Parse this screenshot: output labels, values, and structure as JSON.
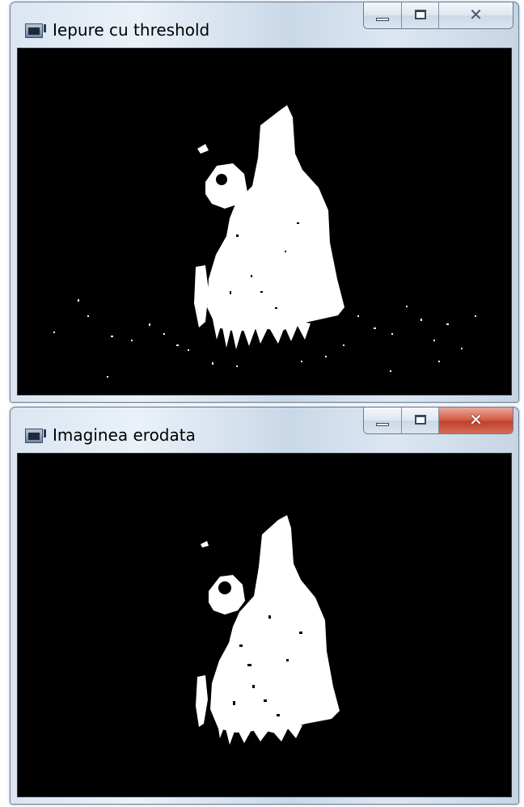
{
  "windows": [
    {
      "title": "Iepure cu threshold",
      "icon": "opencv-window-icon",
      "controls": {
        "minimize": "minimize",
        "maximize": "maximize",
        "close": "close"
      },
      "close_active": false,
      "image": "thresholded-rabbit-image"
    },
    {
      "title": "Imaginea erodata",
      "icon": "opencv-window-icon",
      "controls": {
        "minimize": "minimize",
        "maximize": "maximize",
        "close": "close"
      },
      "close_active": true,
      "image": "eroded-rabbit-image"
    }
  ],
  "colors": {
    "image_background": "#000000",
    "image_foreground": "#ffffff",
    "close_active": "#c1412b"
  }
}
